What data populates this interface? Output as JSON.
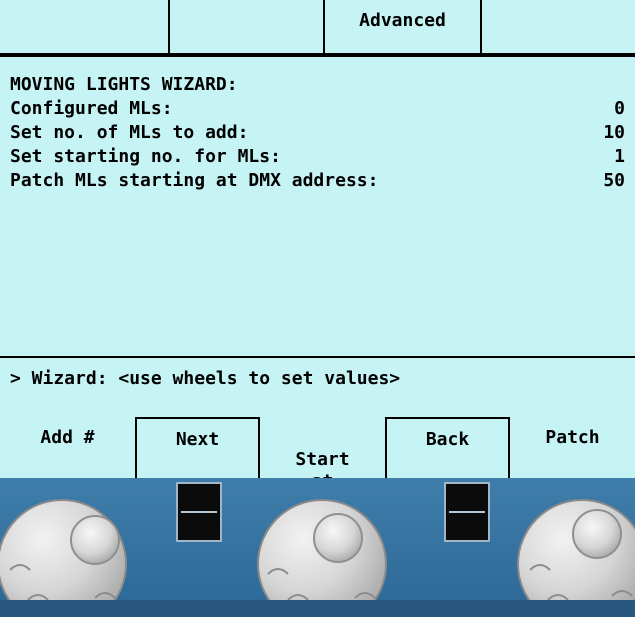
{
  "top_tabs": [
    "",
    "",
    "Advanced",
    ""
  ],
  "wizard": {
    "title": "MOVING LIGHTS WIZARD:",
    "rows": [
      {
        "label": "Configured MLs:",
        "value": "0"
      },
      {
        "label": "Set no. of MLs to add:",
        "value": "10"
      },
      {
        "label": "Set starting no. for MLs:",
        "value": "1"
      },
      {
        "label": "Patch MLs starting at DMX address:",
        "value": "50"
      }
    ],
    "prompt": "> Wizard: <use wheels to set values>"
  },
  "softkeys": [
    {
      "label": "Add #"
    },
    {
      "label": "Next"
    },
    {
      "label": "Start\nat"
    },
    {
      "label": "Back"
    },
    {
      "label": "Patch"
    }
  ],
  "panel": {
    "wheels": [
      "encoder-wheel-left",
      "encoder-wheel-middle",
      "encoder-wheel-right"
    ],
    "indicators": [
      "indicator-led-left",
      "indicator-led-right"
    ]
  }
}
